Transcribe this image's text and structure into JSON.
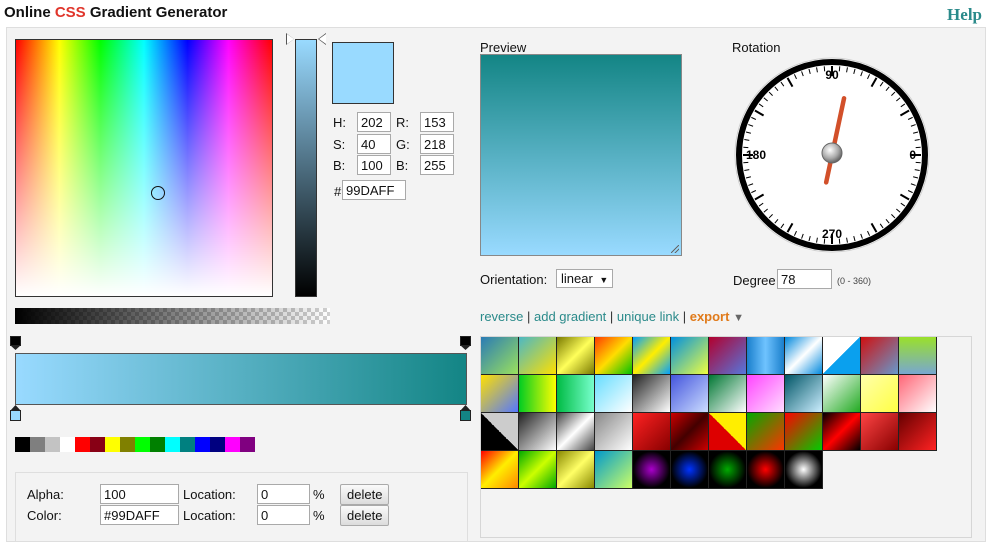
{
  "header": {
    "title_prefix": "Online ",
    "title_css": "CSS",
    "title_suffix": " Gradient Generator",
    "help_label": "Help"
  },
  "color_picker": {
    "h_label": "H:",
    "h": "202",
    "s_label": "S:",
    "s": "40",
    "b_label": "B:",
    "b": "100",
    "r_label": "R:",
    "r": "153",
    "g_label": "G:",
    "g": "218",
    "b2_label": "B:",
    "b2": "255",
    "hex_label": "#",
    "hex": "99DAFF",
    "current_color": "#99DAFF"
  },
  "preview": {
    "label": "Preview",
    "orientation_label": "Orientation:",
    "orientation_value": "linear",
    "colors": [
      "#99DAFF",
      "#138585"
    ]
  },
  "rotation": {
    "label": "Rotation",
    "angle_deg": 78,
    "tick_90": "90",
    "tick_180": "180",
    "tick_0": "0",
    "tick_270": "270",
    "degree_label": "Degree",
    "degree_value": "78",
    "range_hint": "(0 - 360)"
  },
  "links": {
    "reverse": "reverse",
    "add_gradient": "add gradient",
    "unique_link": "unique link",
    "export": "export",
    "export_arrow": "▼",
    "sep": "|"
  },
  "color_palette": [
    "#000000",
    "#7f7f7f",
    "#c3c3c3",
    "#ffffff",
    "#ff0000",
    "#880015",
    "#ffff00",
    "#808000",
    "#00ff00",
    "#008000",
    "#00ffff",
    "#008080",
    "#0000ff",
    "#000080",
    "#ff00ff",
    "#800080"
  ],
  "stop_editor": {
    "alpha_label": "Alpha:",
    "alpha_value": "100",
    "color_label": "Color:",
    "color_value": "#99DAFF",
    "location_label": "Location:",
    "alpha_location": "0",
    "color_location": "0",
    "percent": "%",
    "delete_label": "delete"
  },
  "presets": {
    "rows": [
      [
        "linear-gradient(135deg,#2a7bb5,#9be15d)",
        "linear-gradient(135deg,#4cb8c4,#ffe000)",
        "linear-gradient(135deg,#7a7a00,#ffff5a 50%,#7a7a00)",
        "linear-gradient(135deg,#ff3c00,#ffdd00 50%,#00c000)",
        "linear-gradient(135deg,#00a0ff,#ffee00 50%,#00a0ff)",
        "linear-gradient(135deg,#0090e0,#f0ff40)",
        "linear-gradient(135deg,#b2002d,#5577dd)",
        "linear-gradient(to right,#1a7fcc,#6fc3ff 50%,#1a7fcc)",
        "linear-gradient(135deg,#0088dd,#ffffff 50%,#0088dd)",
        "linear-gradient(135deg,#ffffff 50%,#0aa0ee 50%)",
        "linear-gradient(135deg,#d01010,#6699cc)",
        "linear-gradient(to bottom,#9ae02a,#78a7d0)"
      ],
      [
        "linear-gradient(135deg,#ffe000,#5577ff)",
        "linear-gradient(to right,#00cc22,#ffff00)",
        "linear-gradient(to right,#00bb44,#77ffcc)",
        "linear-gradient(135deg,#66ddff,#ffffff)",
        "linear-gradient(135deg,#222222,#ffffff)",
        "linear-gradient(135deg,#4455dd,#ccddff)",
        "linear-gradient(135deg,#007733,#ffffff)",
        "linear-gradient(135deg,#ff44ff,#ffddff)",
        "linear-gradient(135deg,#005566,#cceeff)",
        "linear-gradient(135deg,#ffffff,#22aa22)",
        "linear-gradient(135deg,#ffffaa,#ffff44)",
        "linear-gradient(135deg,#ff6677,#ffffff)"
      ],
      [
        "linear-gradient(45deg,#000000 50%,#cccccc 50%)",
        "linear-gradient(135deg,#222222,#ffffff)",
        "linear-gradient(135deg,#444444,#ffffff 50%,#444444)",
        "linear-gradient(135deg,#888888,#ffffff)",
        "linear-gradient(135deg,#ff2222,#880000)",
        "linear-gradient(135deg,#cc0000,#440000 50%,#cc0000)",
        "linear-gradient(45deg,#dd0000 50%,#ffee00 50%)",
        "linear-gradient(135deg,#00aa00,#ff3300)",
        "linear-gradient(135deg,#ff0000,#00cc00)",
        "linear-gradient(135deg,#000000,#ff0000 50%,#000000)",
        "linear-gradient(135deg,#ff4444,#880000)",
        "linear-gradient(135deg,#660000,#ff2222)"
      ],
      [
        "linear-gradient(135deg,#ff0000,#ffee00 50%,#ff8800)",
        "linear-gradient(135deg,#00aa00,#ccff00 50%,#00aa00)",
        "linear-gradient(135deg,#888800,#ffff66 50%,#888800)",
        "linear-gradient(135deg,#0099cc,#ccff66)",
        "radial-gradient(circle,#aa00cc,#000000 70%)",
        "radial-gradient(circle,#0033ff,#000000 70%)",
        "radial-gradient(circle,#00aa00,#000000 70%)",
        "radial-gradient(circle,#ff0000,#000000 70%)",
        "radial-gradient(circle,#ffffff,#000000 70%)"
      ]
    ]
  }
}
